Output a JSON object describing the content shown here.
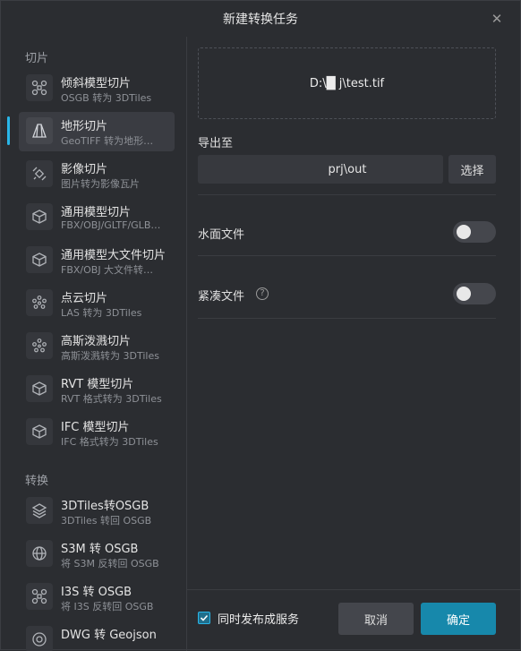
{
  "dialog": {
    "title": "新建转换任务"
  },
  "sidebar": {
    "section_tiles": "切片",
    "section_convert": "转换",
    "items": [
      {
        "label": "倾斜模型切片",
        "sub": "OSGB 转为 3DTiles",
        "icon": "drone-icon"
      },
      {
        "label": "地形切片",
        "sub": "GeoTIFF 转为地形…",
        "icon": "terrain-icon"
      },
      {
        "label": "影像切片",
        "sub": "图片转为影像瓦片",
        "icon": "satellite-icon"
      },
      {
        "label": "通用模型切片",
        "sub": "FBX/OBJ/GLTF/GLB…",
        "icon": "cube-icon"
      },
      {
        "label": "通用模型大文件切片",
        "sub": "FBX/OBJ 大文件转…",
        "icon": "cube-icon"
      },
      {
        "label": "点云切片",
        "sub": "LAS 转为 3DTiles",
        "icon": "point-cloud-icon"
      },
      {
        "label": "高斯泼溅切片",
        "sub": "高斯泼溅转为 3DTiles",
        "icon": "gaussian-splat-icon"
      },
      {
        "label": "RVT 模型切片",
        "sub": "RVT 格式转为 3DTiles",
        "icon": "cube-icon"
      },
      {
        "label": "IFC 模型切片",
        "sub": "IFC 格式转为 3DTiles",
        "icon": "cube-icon"
      },
      {
        "label": "3DTiles转OSGB",
        "sub": "3DTiles 转回 OSGB",
        "icon": "layers-icon"
      },
      {
        "label": "S3M 转 OSGB",
        "sub": "将 S3M 反转回 OSGB",
        "icon": "globe-icon"
      },
      {
        "label": "I3S 转 OSGB",
        "sub": "将 I3S 反转回 OSGB",
        "icon": "drone-icon"
      },
      {
        "label": "DWG 转 Geojson",
        "sub": "",
        "icon": "dwg-icon"
      }
    ]
  },
  "main": {
    "source_path": "D:\\█                  j\\test.tif",
    "export_label": "导出至",
    "export_path": "prj\\out",
    "choose_label": "选择",
    "water_label": "水面文件",
    "water_on": false,
    "compact_label": "紧凑文件",
    "compact_on": false
  },
  "footer": {
    "publish_label": "同时发布成服务",
    "publish_checked": true,
    "cancel_label": "取消",
    "ok_label": "确定"
  },
  "colors": {
    "accent": "#29b6e8",
    "primary_button": "#1788ab",
    "background": "#2b2d31"
  }
}
